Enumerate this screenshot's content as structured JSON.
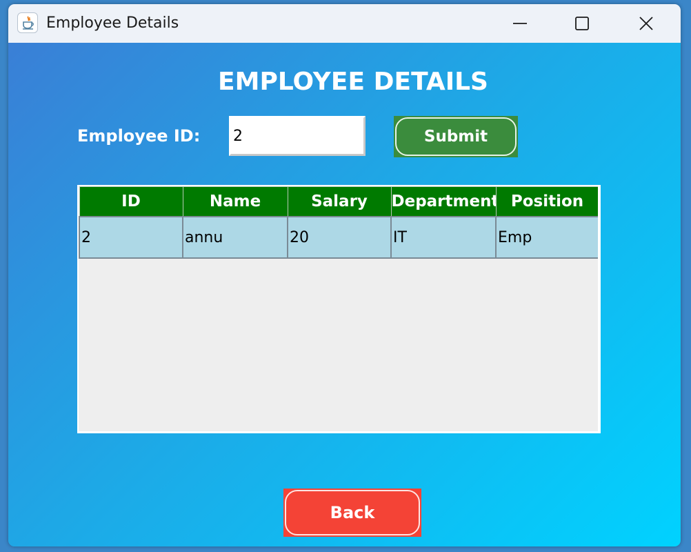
{
  "window": {
    "title": "Employee Details",
    "app_icon": "java-cup-icon",
    "controls": [
      "minimize-icon",
      "maximize-icon",
      "close-icon"
    ]
  },
  "page": {
    "heading": "EMPLOYEE DETAILS",
    "employee_id_label": "Employee ID:",
    "employee_id_value": "2",
    "submit_label": "Submit",
    "back_label": "Back"
  },
  "table": {
    "columns": [
      "ID",
      "Name",
      "Salary",
      "Department",
      "Position"
    ],
    "rows": [
      [
        "2",
        "annu",
        "20",
        "IT",
        "Emp"
      ]
    ]
  },
  "colors": {
    "header_bg": "#007a00",
    "row_bg": "#add8e6",
    "submit_bg": "#3b8c3d",
    "back_bg": "#f44336",
    "gradient_start": "#3a7fd6",
    "gradient_end": "#00d2ff"
  }
}
